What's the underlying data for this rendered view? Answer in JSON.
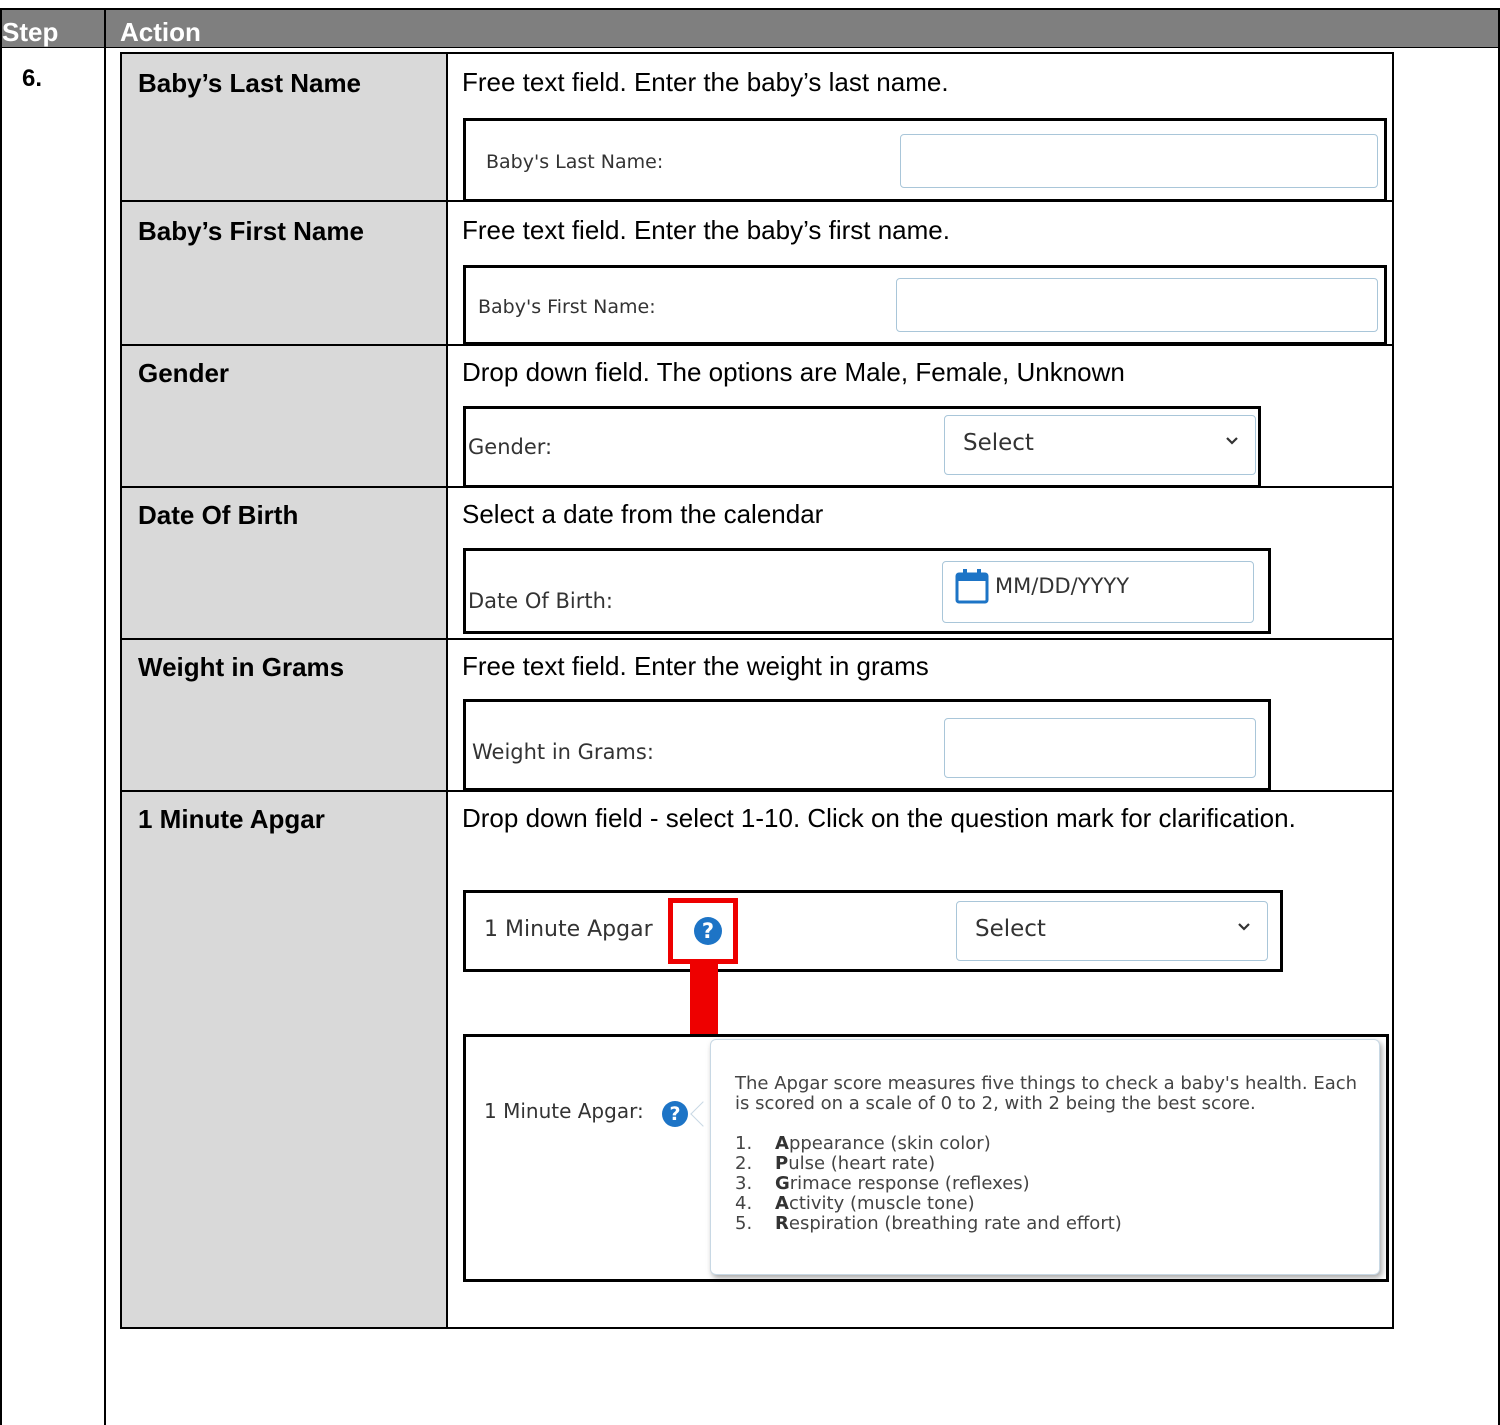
{
  "header": {
    "step": "Step",
    "action": "Action"
  },
  "step_number": "6.",
  "rows": [
    {
      "label": "Baby’s Last Name",
      "desc": "Free text field. Enter the baby’s last name.",
      "shot_label": "Baby's Last Name:"
    },
    {
      "label": "Baby’s First Name",
      "desc": "Free text field. Enter the baby’s first name.",
      "shot_label": "Baby's First Name:"
    },
    {
      "label": "Gender",
      "desc": "Drop down field. The options are Male, Female, Unknown",
      "shot_label": "Gender:",
      "select": "Select"
    },
    {
      "label": "Date Of Birth",
      "desc": "Select a date from the calendar",
      "shot_label": "Date Of Birth:",
      "placeholder": "MM/DD/YYYY"
    },
    {
      "label": "Weight in Grams",
      "desc": "Free text field. Enter the weight in grams",
      "shot_label": "Weight in Grams:"
    },
    {
      "label": "1 Minute Apgar",
      "desc": "Drop down field - select 1-10. Click on the question mark for clarification.",
      "shot_label": "1 Minute Apgar",
      "select": "Select",
      "shot2_label": "1 Minute Apgar:"
    }
  ],
  "tooltip": {
    "intro": "The Apgar score measures five things to check a baby's health. Each is scored on a scale of 0 to 2, with 2 being the best score.",
    "items": [
      {
        "n": "1.",
        "letter": "A",
        "rest": "ppearance (skin color)"
      },
      {
        "n": "2.",
        "letter": "P",
        "rest": "ulse (heart rate)"
      },
      {
        "n": "3.",
        "letter": "G",
        "rest": "rimace response (reflexes)"
      },
      {
        "n": "4.",
        "letter": "A",
        "rest": "ctivity (muscle tone)"
      },
      {
        "n": "5.",
        "letter": "R",
        "rest": "espiration (breathing rate and effort)"
      }
    ]
  },
  "colors": {
    "header_bg": "#7f7f7f",
    "label_bg": "#d9d9d9",
    "highlight": "#ee0000",
    "arrow": "#ee0000",
    "help_icon": "#1d74c6"
  }
}
